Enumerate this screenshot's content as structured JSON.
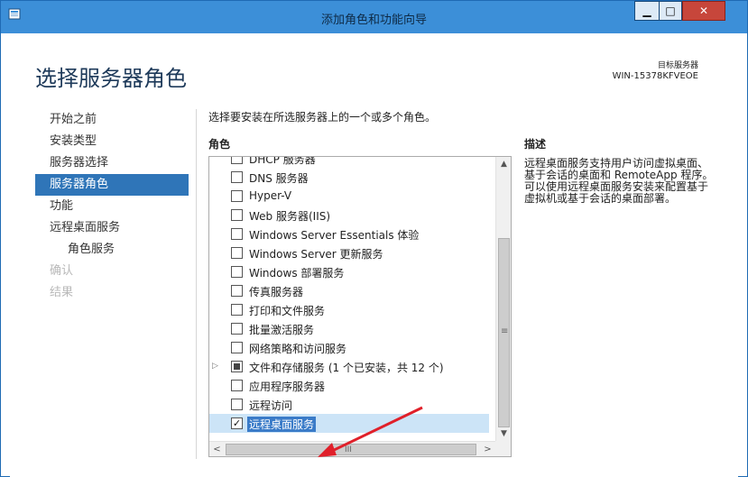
{
  "window": {
    "title": "添加角色和功能向导",
    "controls": [
      "minimize-icon",
      "maximize-icon",
      "close-icon"
    ]
  },
  "header": {
    "page_title": "选择服务器角色",
    "target_label": "目标服务器",
    "target_name": "WIN-15378KFVEOE"
  },
  "sidebar": {
    "items": [
      {
        "label": "开始之前",
        "state": "normal"
      },
      {
        "label": "安装类型",
        "state": "normal"
      },
      {
        "label": "服务器选择",
        "state": "normal"
      },
      {
        "label": "服务器角色",
        "state": "active"
      },
      {
        "label": "功能",
        "state": "normal"
      },
      {
        "label": "远程桌面服务",
        "state": "normal"
      },
      {
        "label": "角色服务",
        "state": "indent"
      },
      {
        "label": "确认",
        "state": "disabled"
      },
      {
        "label": "结果",
        "state": "disabled"
      }
    ]
  },
  "main": {
    "instruction": "选择要安装在所选服务器上的一个或多个角色。",
    "roles_heading": "角色",
    "roles": [
      {
        "label": "DHCP 服务器",
        "checked": false
      },
      {
        "label": "DNS 服务器",
        "checked": false
      },
      {
        "label": "Hyper-V",
        "checked": false
      },
      {
        "label": "Web 服务器(IIS)",
        "checked": false
      },
      {
        "label": "Windows Server Essentials 体验",
        "checked": false
      },
      {
        "label": "Windows Server 更新服务",
        "checked": false
      },
      {
        "label": "Windows 部署服务",
        "checked": false
      },
      {
        "label": "传真服务器",
        "checked": false
      },
      {
        "label": "打印和文件服务",
        "checked": false
      },
      {
        "label": "批量激活服务",
        "checked": false
      },
      {
        "label": "网络策略和访问服务",
        "checked": false
      },
      {
        "label": "文件和存储服务 (1 个已安装，共 12 个)",
        "checked": "partial",
        "expandable": true
      },
      {
        "label": "应用程序服务器",
        "checked": false
      },
      {
        "label": "远程访问",
        "checked": false
      },
      {
        "label": "远程桌面服务",
        "checked": true,
        "selected": true
      }
    ]
  },
  "description": {
    "heading": "描述",
    "text": "远程桌面服务支持用户访问虚拟桌面、基于会话的桌面和 RemoteApp 程序。可以使用远程桌面服务安装来配置基于虚拟机或基于会话的桌面部署。"
  },
  "scrollbars": {
    "up": "▲",
    "down": "▼",
    "left": "<",
    "right": ">",
    "vgrip": "≡",
    "hgrip": "III"
  },
  "colors": {
    "titlebar": "#3c8fd8",
    "active_nav": "#2f75b8",
    "selection": "#3a7bc8",
    "arrow": "#e0202a"
  }
}
